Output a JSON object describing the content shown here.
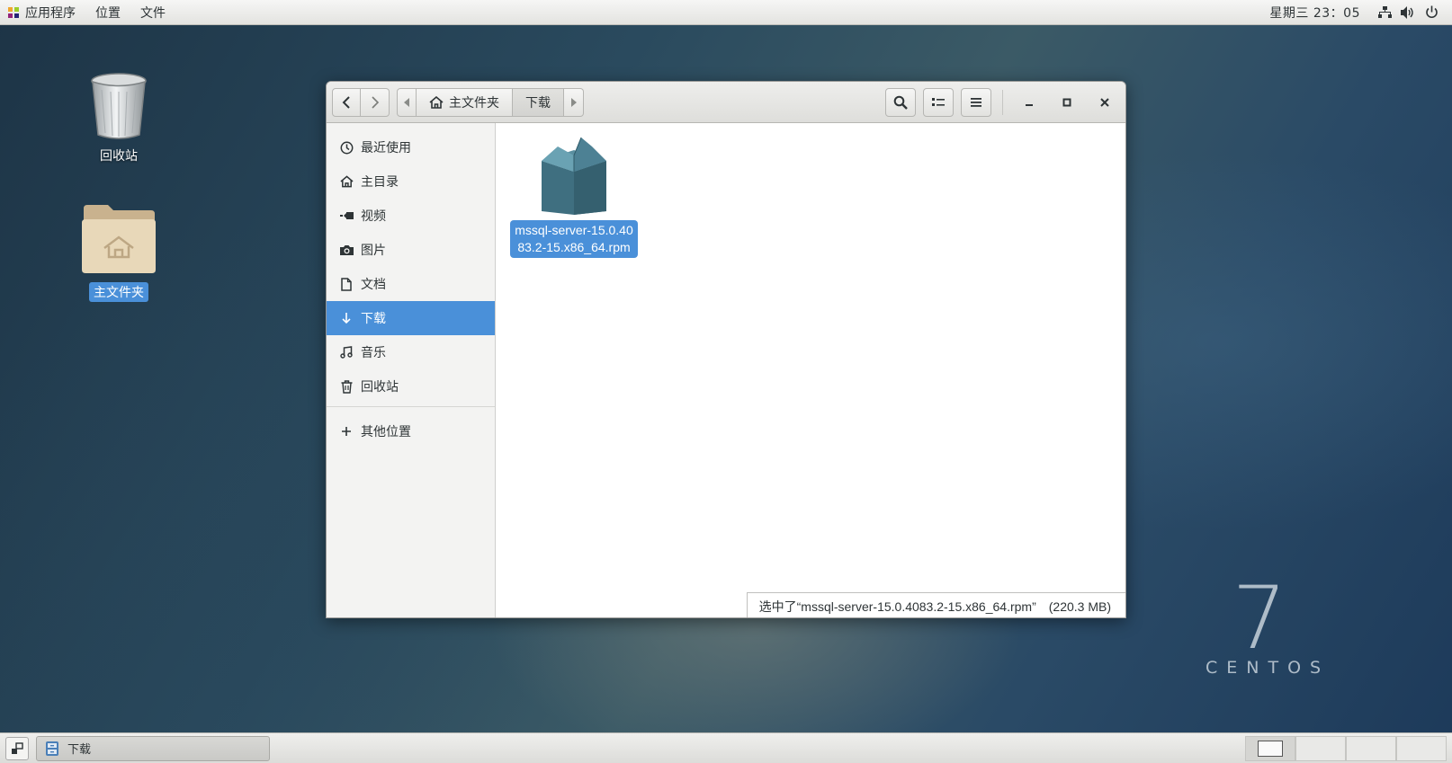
{
  "topbar": {
    "menu": [
      "应用程序",
      "位置",
      "文件"
    ],
    "clock": "星期三 23：05"
  },
  "desktop": {
    "trash_label": "回收站",
    "home_label": "主文件夹"
  },
  "window": {
    "path": {
      "home": "主文件夹",
      "current": "下载"
    },
    "sidebar": {
      "items": [
        {
          "label": "最近使用",
          "icon": "clock-icon"
        },
        {
          "label": "主目录",
          "icon": "home-icon"
        },
        {
          "label": "视频",
          "icon": "video-icon"
        },
        {
          "label": "图片",
          "icon": "camera-icon"
        },
        {
          "label": "文档",
          "icon": "document-icon"
        },
        {
          "label": "下载",
          "icon": "download-icon"
        },
        {
          "label": "音乐",
          "icon": "music-icon"
        },
        {
          "label": "回收站",
          "icon": "trash-icon"
        }
      ],
      "other": "其他位置"
    },
    "file": {
      "name": "mssql-server-15.0.4083.2-15.x86_64.rpm"
    },
    "status": {
      "text": "选中了“mssql-server-15.0.4083.2-15.x86_64.rpm”",
      "size": "(220.3 MB)"
    }
  },
  "brand": {
    "number": "7",
    "name": "CENTOS"
  },
  "taskbar": {
    "task_label": "下载"
  },
  "colors": {
    "accent": "#4a90d9"
  }
}
